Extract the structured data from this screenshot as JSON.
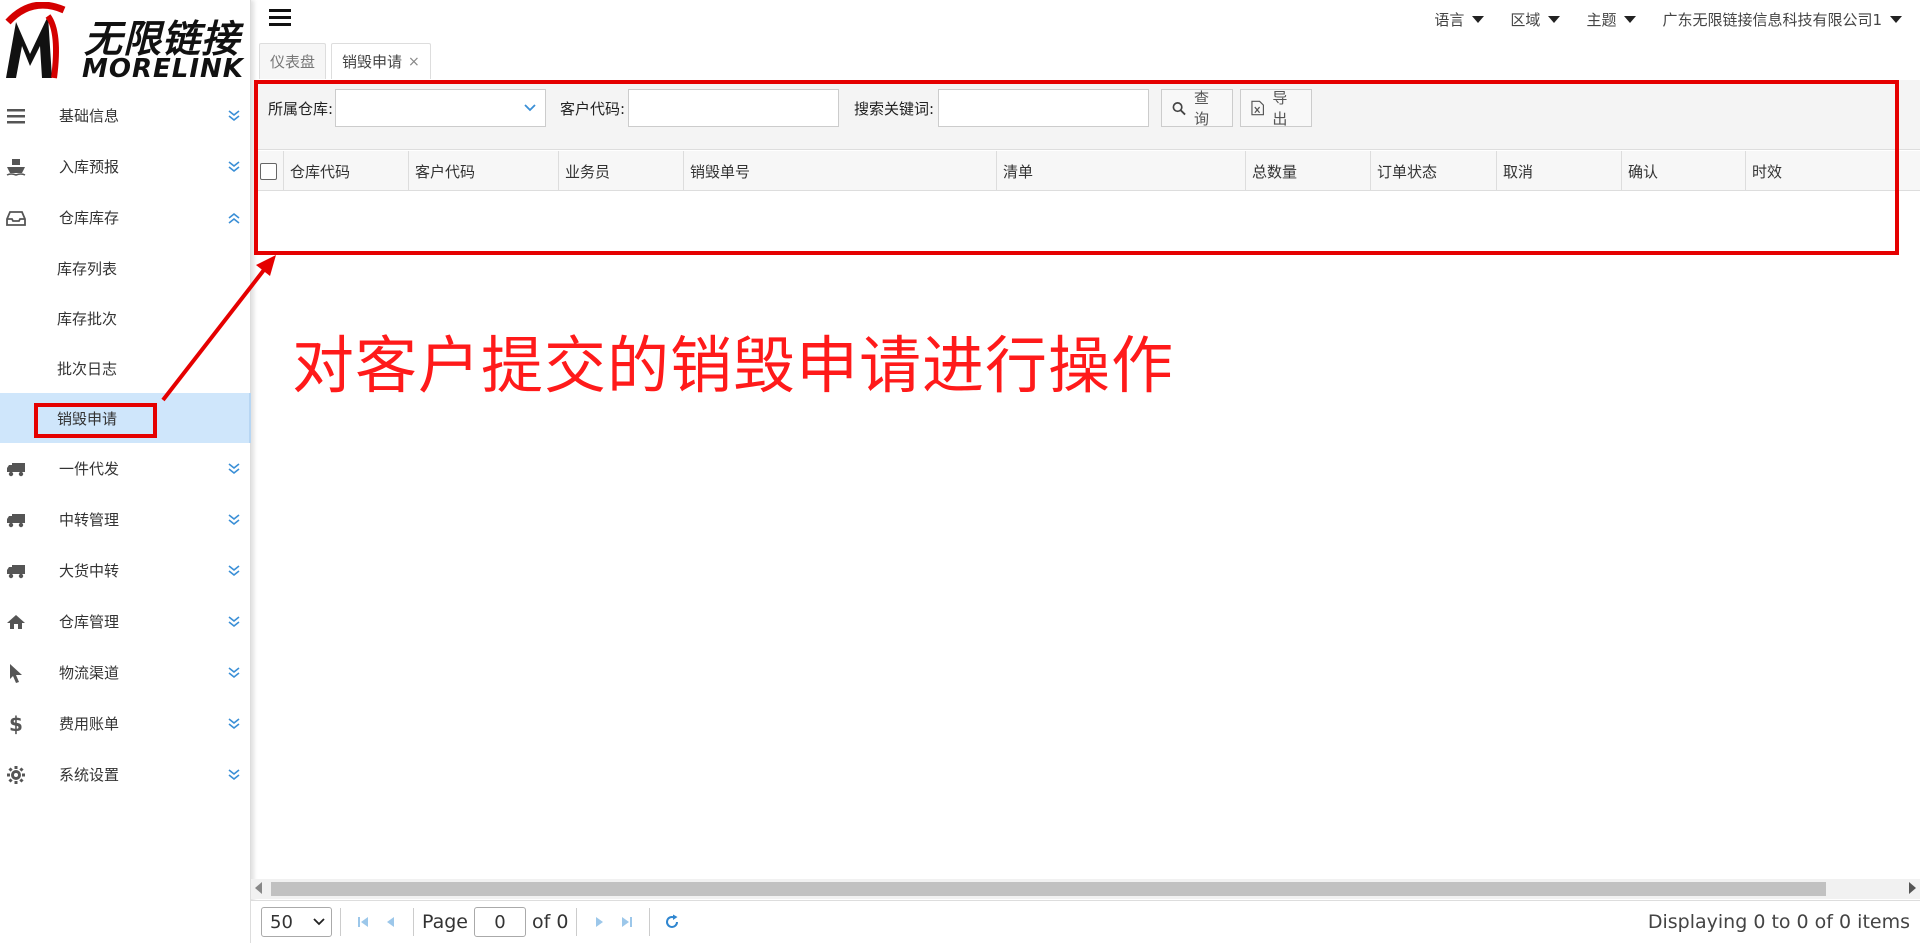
{
  "logo": {
    "cn": "无限链接",
    "en": "MORELINK"
  },
  "sidebar": {
    "items": [
      {
        "label": "基础信息",
        "icon": "list-icon",
        "expanded": false
      },
      {
        "label": "入库预报",
        "icon": "ship-icon",
        "expanded": false
      },
      {
        "label": "仓库库存",
        "icon": "inbox-icon",
        "expanded": true,
        "children": [
          {
            "label": "库存列表"
          },
          {
            "label": "库存批次"
          },
          {
            "label": "批次日志"
          },
          {
            "label": "销毁申请",
            "active": true
          }
        ]
      },
      {
        "label": "一件代发",
        "icon": "truck-icon",
        "expanded": false
      },
      {
        "label": "中转管理",
        "icon": "truck-icon",
        "expanded": false
      },
      {
        "label": "大货中转",
        "icon": "truck-icon",
        "expanded": false
      },
      {
        "label": "仓库管理",
        "icon": "home-icon",
        "expanded": false
      },
      {
        "label": "物流渠道",
        "icon": "cursor-icon",
        "expanded": false
      },
      {
        "label": "费用账单",
        "icon": "dollar-icon",
        "expanded": false
      },
      {
        "label": "系统设置",
        "icon": "gear-icon",
        "expanded": false
      }
    ]
  },
  "topbar": {
    "language": "语言",
    "region": "区域",
    "theme": "主题",
    "company": "广东无限链接信息科技有限公司1"
  },
  "tabs": [
    {
      "label": "仪表盘",
      "active": false,
      "closable": false
    },
    {
      "label": "销毁申请",
      "active": true,
      "closable": true,
      "close": "×"
    }
  ],
  "search": {
    "warehouse_label": "所属仓库:",
    "warehouse_value": "",
    "customer_label": "客户代码:",
    "customer_value": "",
    "keyword_label": "搜索关键词:",
    "keyword_value": "",
    "query_button": "查询",
    "export_button": "导出"
  },
  "grid": {
    "columns": [
      "仓库代码",
      "客户代码",
      "业务员",
      "销毁单号",
      "清单",
      "总数量",
      "订单状态",
      "取消",
      "确认",
      "时效"
    ],
    "rows": []
  },
  "annotation": {
    "text": "对客户提交的销毁申请进行操作",
    "color": "#e50000"
  },
  "pager": {
    "page_size": "50",
    "page_label": "Page",
    "page_value": "0",
    "of_label": "of 0",
    "display": "Displaying 0 to 0 of 0 items"
  }
}
